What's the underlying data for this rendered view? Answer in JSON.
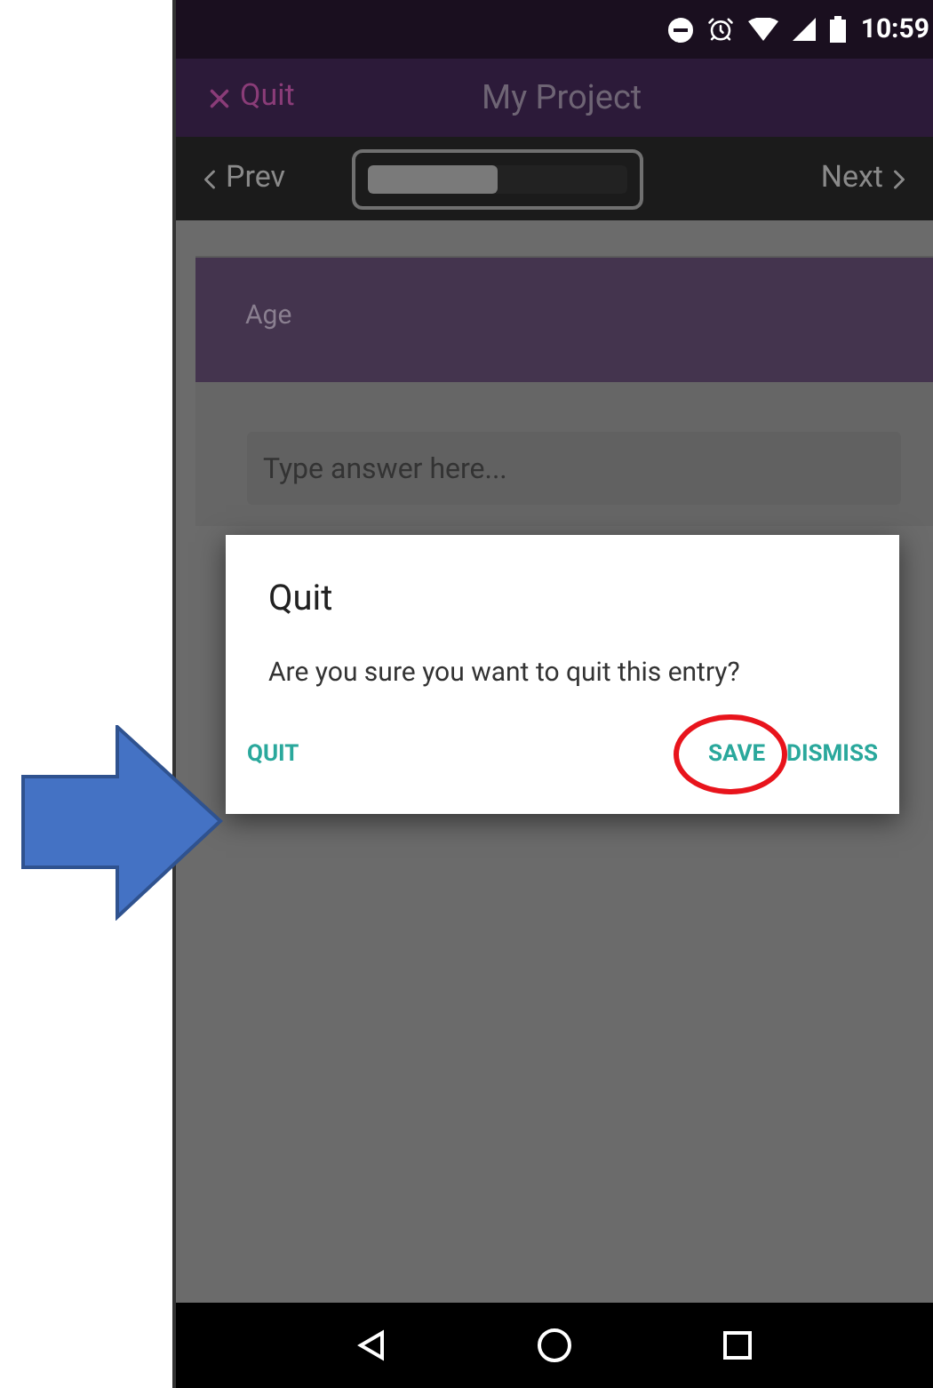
{
  "status_bar": {
    "time": "10:59"
  },
  "toolbar": {
    "quit": "Quit",
    "title": "My Project"
  },
  "nav": {
    "prev": "Prev",
    "next": "Next",
    "level": 0.5
  },
  "question": {
    "label": "Age",
    "placeholder": "Type answer here..."
  },
  "dialog": {
    "title": "Quit",
    "message": "Are you sure you want to quit this entry?",
    "buttons": [
      {
        "label": "QUIT",
        "highlighted": false
      },
      {
        "label": "SAVE",
        "highlighted": true
      },
      {
        "label": "DISMISS",
        "highlighted": false
      }
    ]
  }
}
